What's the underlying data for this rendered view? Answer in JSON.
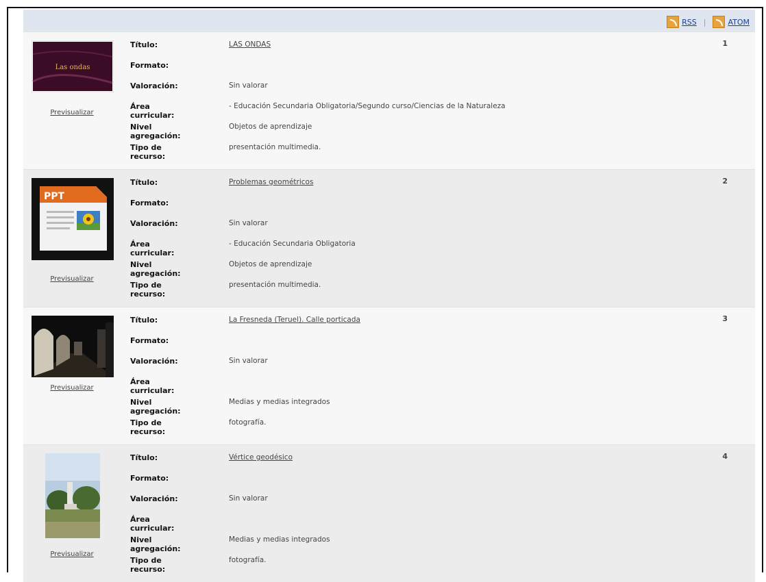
{
  "feeds": {
    "rss_label": "RSS",
    "atom_label": "ATOM",
    "separator": "|"
  },
  "labels": {
    "titulo": "Título:",
    "formato": "Formato:",
    "valoracion": "Valoración:",
    "area": "Área curricular:",
    "nivel": "Nivel agregación:",
    "tipo": "Tipo de recurso:"
  },
  "preview_label": "Previsualizar",
  "results": [
    {
      "number": "1",
      "thumbnail": "presentation-slide-las-ondas",
      "thumbnail_text": "Las ondas",
      "title": "LAS ONDAS",
      "formato": "",
      "valoracion": "Sin valorar",
      "area": "- Educación Secundaria Obligatoria/Segundo curso/Ciencias de la Naturaleza",
      "nivel": "Objetos de aprendizaje",
      "tipo": "presentación multimedia."
    },
    {
      "number": "2",
      "thumbnail": "ppt-file-icon",
      "thumbnail_text": "PPT",
      "title": "Problemas geométricos",
      "formato": "",
      "valoracion": "Sin valorar",
      "area": "- Educación Secundaria Obligatoria",
      "nivel": "Objetos de aprendizaje",
      "tipo": "presentación multimedia."
    },
    {
      "number": "3",
      "thumbnail": "photo-arcade-street",
      "title": "La Fresneda (Teruel). Calle porticada",
      "formato": "",
      "valoracion": "Sin valorar",
      "area": "",
      "nivel": "Medias y medias integrados",
      "tipo": "fotografía."
    },
    {
      "number": "4",
      "thumbnail": "photo-geodesic-marker",
      "title": "Vértice geodésico",
      "formato": "",
      "valoracion": "Sin valorar",
      "area": "",
      "nivel": "Medias y medias integrados",
      "tipo": "fotografía."
    }
  ]
}
